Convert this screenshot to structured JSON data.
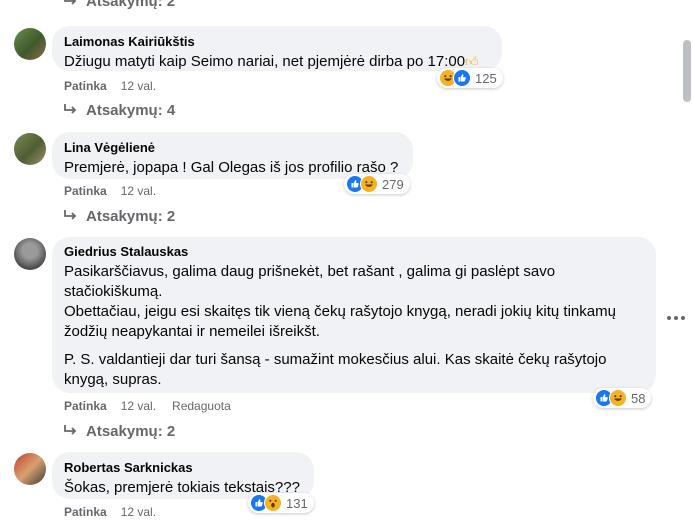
{
  "replies_label_prefix": "Atsakymų:",
  "like_label": "Patinka",
  "top_replies": {
    "count": "2"
  },
  "comments": [
    {
      "author": "Laimonas Kairiūkštis",
      "text": [
        "Džiugu matyti kaip Seimo nariai, net pjemjėrė dirba po 17:00"
      ],
      "like": "Patinka",
      "time": "12 val.",
      "edited": "",
      "reactions": [
        "haha",
        "like"
      ],
      "reaction_count": "125",
      "replies": "Atsakymų: 4"
    },
    {
      "author": "Lina Vėgėlienė",
      "text": [
        "Premjerė, jopapa ! Gal Olegas iš jos profilio rašo ?"
      ],
      "like": "Patinka",
      "time": "12 val.",
      "edited": "",
      "reactions": [
        "like",
        "haha"
      ],
      "reaction_count": "279",
      "replies": "Atsakymų: 2"
    },
    {
      "author": "Giedrius Stalauskas",
      "paragraphs": [
        "Pasikarščiavus, galima daug prišnekėt, bet rašant , galima gi paslėpt savo stačiokiškumą.\nObettačiau, jeigu esi skaitęs tik vieną čekų rašytojo knygą, neradi jokių kitų tinkamų žodžių neapykantai ir nemeilei išreikšt.",
        "P. S. valdantieji dar turi šansą - sumažint mokesčius alui. Kas skaitė čekų rašytojo knygą, supras."
      ],
      "like": "Patinka",
      "time": "12 val.",
      "edited": "Redaguota",
      "reactions": [
        "like",
        "haha"
      ],
      "reaction_count": "58",
      "replies": "Atsakymų: 2"
    },
    {
      "author": "Robertas Sarknickas",
      "text": [
        "Šokas, premjerė tokiais tekstais???"
      ],
      "like": "Patinka",
      "time": "12 val.",
      "edited": "",
      "reactions": [
        "like",
        "wow"
      ],
      "reaction_count": "131",
      "replies": ""
    }
  ],
  "colors": {
    "bubble": "#f0f2f5",
    "meta_text": "#65676b",
    "like_blue": "#1877f2",
    "haha_yellow": "#f7b125"
  },
  "icons": {
    "reply_arrow": "reply-arrow-icon",
    "more": "more-options-icon",
    "thumbs_up_emoji": "thumbs-up-emoji-icon"
  }
}
